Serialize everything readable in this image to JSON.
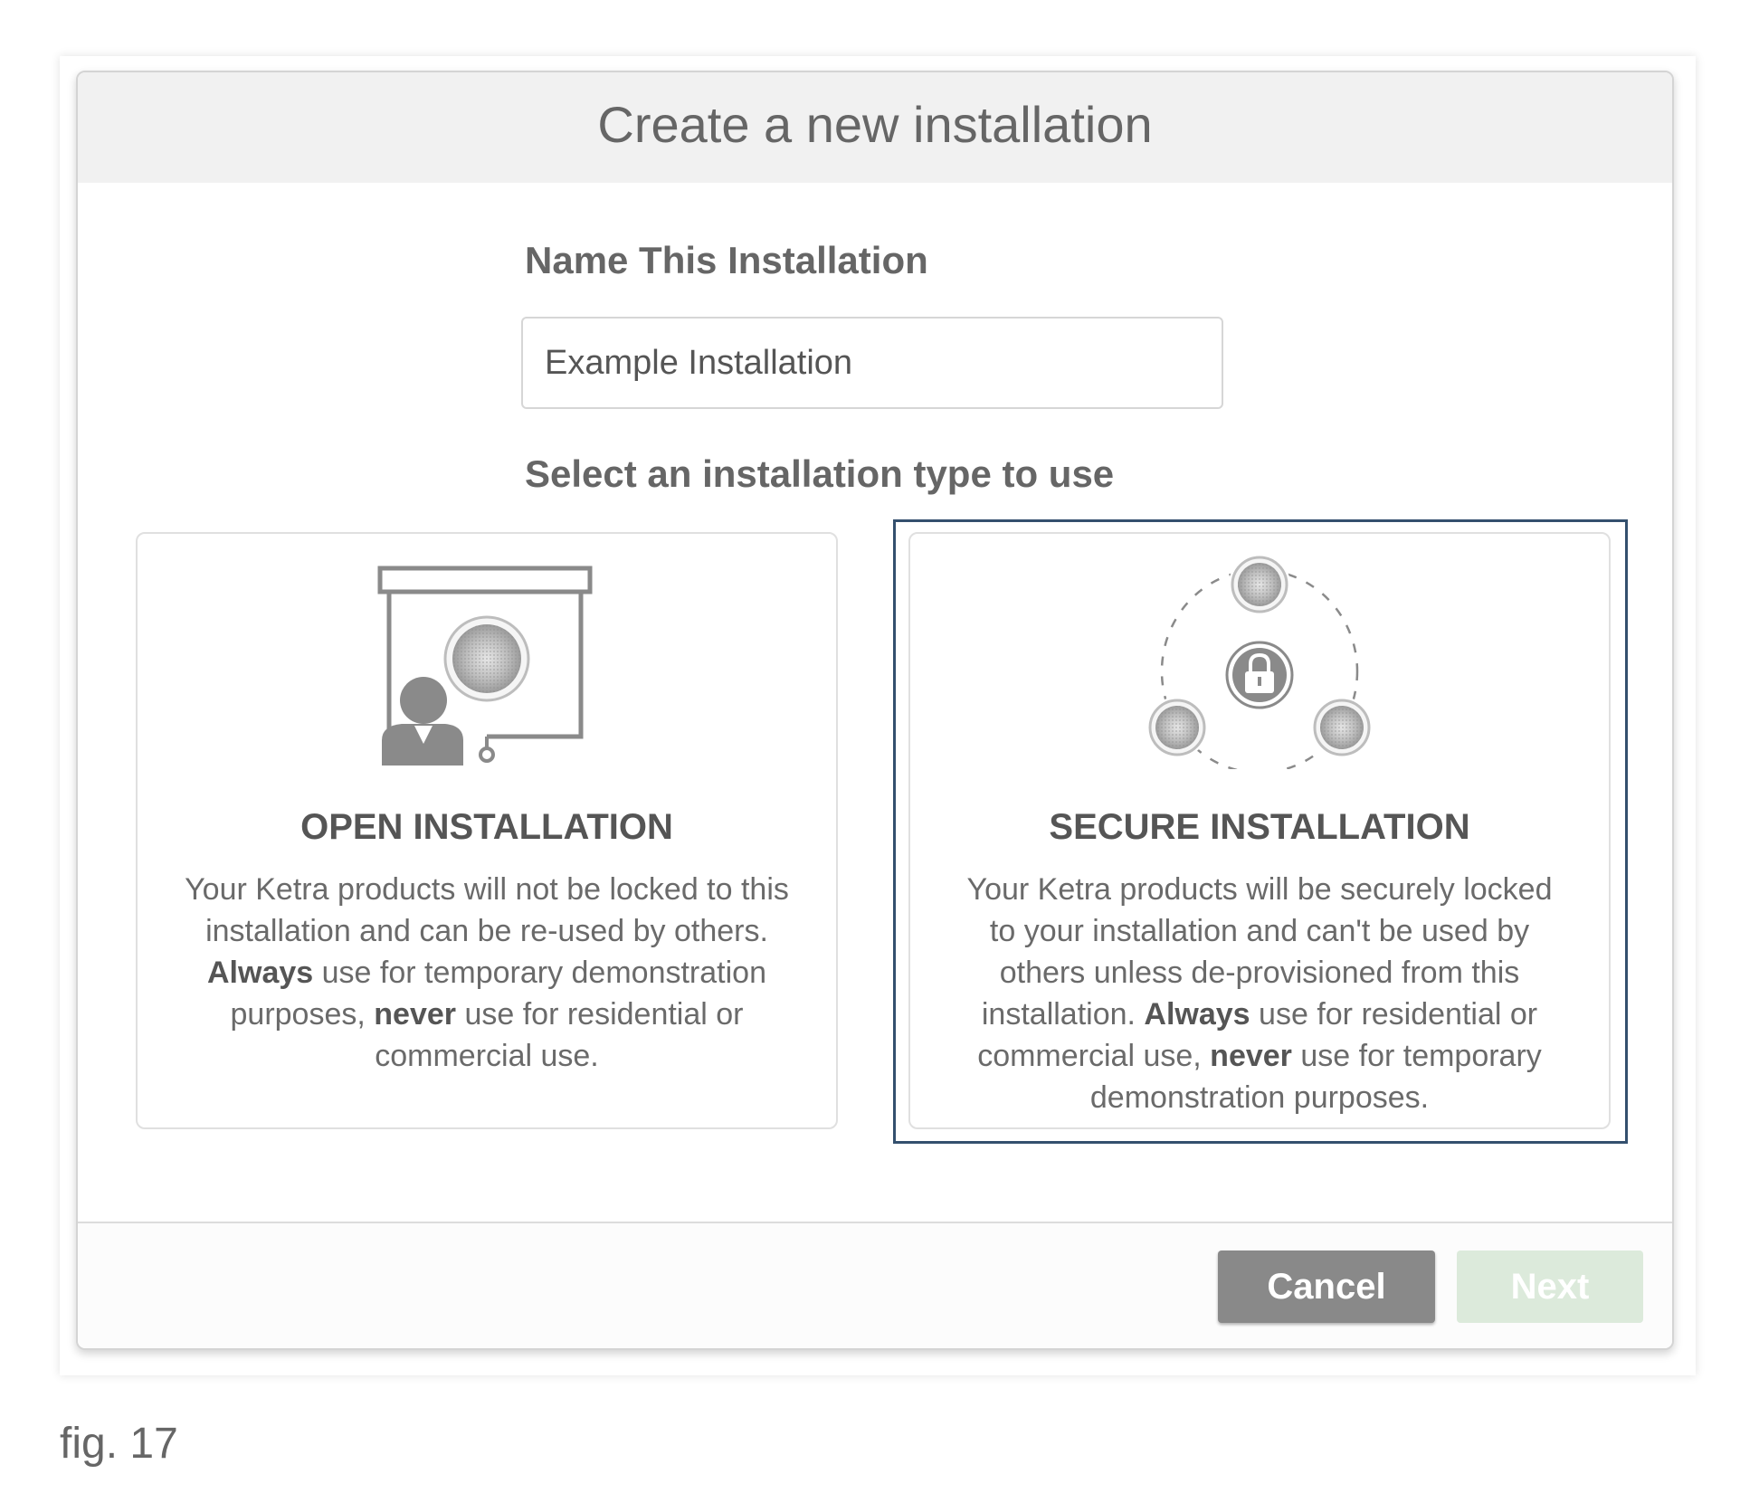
{
  "dialog": {
    "title": "Create a new installation",
    "name_label": "Name This Installation",
    "name_value": "Example Installation",
    "type_label": "Select an installation type to use"
  },
  "options": [
    {
      "id": "open",
      "title": "OPEN INSTALLATION",
      "icon": "presentation-icon",
      "desc_1": "Your Ketra products will not be locked to this installation and can be re-used by others. ",
      "desc_bold_1": "Always",
      "desc_2": " use for temporary demonstration purposes, ",
      "desc_bold_2": "never",
      "desc_3": " use for residential or commercial use.",
      "selected": false
    },
    {
      "id": "secure",
      "title": "SECURE INSTALLATION",
      "icon": "secure-network-lock-icon",
      "desc_1": "Your Ketra products will be securely locked to your installation and can't be used by others unless de-provisioned from this installation. ",
      "desc_bold_1": "Always",
      "desc_2": " use for residential or commercial use, ",
      "desc_bold_2": "never",
      "desc_3": " use for temporary demonstration purposes.",
      "selected": true
    }
  ],
  "footer": {
    "cancel_label": "Cancel",
    "next_label": "Next",
    "next_enabled": false
  },
  "caption": "fig. 17",
  "colors": {
    "selected_border": "#34506e",
    "cancel_bg": "#898989",
    "next_bg_disabled": "#dceadb"
  }
}
